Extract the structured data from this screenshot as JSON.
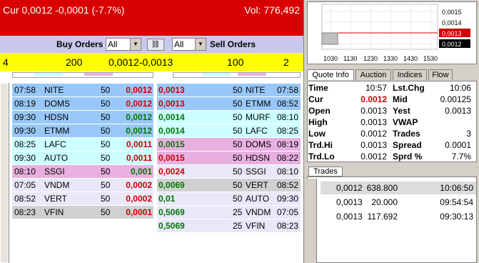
{
  "header": {
    "title": "Cur 0,0012 -0,0001 (-7.7%)",
    "volume": "Vol: 776,492"
  },
  "controls": {
    "buy_label": "Buy Orders",
    "buy_filter": "All",
    "sell_filter": "All",
    "sell_label": "Sell Orders"
  },
  "summary": {
    "bid_count": "4",
    "bid_size": "200",
    "bid_ask": "0,0012-0,0013",
    "ask_size": "100",
    "ask_count": "2"
  },
  "buy_orders": [
    {
      "time": "07:58",
      "mm": "NITE",
      "size": "50",
      "price": "0,0012",
      "color": "red"
    },
    {
      "time": "08:19",
      "mm": "DOMS",
      "size": "50",
      "price": "0,0012",
      "color": "red"
    },
    {
      "time": "09:30",
      "mm": "HDSN",
      "size": "50",
      "price": "0,0012",
      "color": "grn"
    },
    {
      "time": "09:30",
      "mm": "ETMM",
      "size": "50",
      "price": "0,0012",
      "color": "grn"
    },
    {
      "time": "08:25",
      "mm": "LAFC",
      "size": "50",
      "price": "0,0011",
      "color": "red"
    },
    {
      "time": "09:30",
      "mm": "AUTO",
      "size": "50",
      "price": "0,0011",
      "color": "red"
    },
    {
      "time": "08:10",
      "mm": "SSGI",
      "size": "50",
      "price": "0,001",
      "color": "grn"
    },
    {
      "time": "07:05",
      "mm": "VNDM",
      "size": "50",
      "price": "0,0002",
      "color": "red"
    },
    {
      "time": "08:52",
      "mm": "VERT",
      "size": "50",
      "price": "0,0002",
      "color": "red"
    },
    {
      "time": "08:23",
      "mm": "VFIN",
      "size": "50",
      "price": "0,0001",
      "color": "red"
    }
  ],
  "sell_orders": [
    {
      "price": "0,0013",
      "size": "50",
      "mm": "NITE",
      "time": "07:58",
      "color": "red"
    },
    {
      "price": "0,0013",
      "size": "50",
      "mm": "ETMM",
      "time": "08:52",
      "color": "red"
    },
    {
      "price": "0,0014",
      "size": "50",
      "mm": "MURF",
      "time": "08:10",
      "color": "grn"
    },
    {
      "price": "0,0014",
      "size": "50",
      "mm": "LAFC",
      "time": "08:25",
      "color": "grn"
    },
    {
      "price": "0,0015",
      "size": "50",
      "mm": "DOMS",
      "time": "08:19",
      "color": "grn"
    },
    {
      "price": "0,0015",
      "size": "50",
      "mm": "HDSN",
      "time": "08:22",
      "color": "red"
    },
    {
      "price": "0,0024",
      "size": "50",
      "mm": "SSGI",
      "time": "08:10",
      "color": "red"
    },
    {
      "price": "0,0069",
      "size": "50",
      "mm": "VERT",
      "time": "08:52",
      "color": "grn"
    },
    {
      "price": "0,01",
      "size": "50",
      "mm": "AUTO",
      "time": "09:30",
      "color": "grn"
    },
    {
      "price": "0,5069",
      "size": "25",
      "mm": "VNDM",
      "time": "07:05",
      "color": "grn"
    },
    {
      "price": "0,5069",
      "size": "25",
      "mm": "VFIN",
      "time": "08:23",
      "color": "grn"
    }
  ],
  "chart": {
    "x_ticks": [
      "1030",
      "1130",
      "1230",
      "1330",
      "1430",
      "1530"
    ],
    "y_ticks": [
      "0,0015",
      "0,0014",
      "0,0013",
      "0,0012"
    ]
  },
  "tabs": [
    "Quote Info",
    "Auction",
    "Indices",
    "Flow"
  ],
  "quote": {
    "time_label": "Time",
    "time": "10:57",
    "lstchg_label": "Lst.Chg",
    "lstchg": "10:06",
    "cur_label": "Cur",
    "cur": "0.0012",
    "mid_label": "Mid",
    "mid": "0.00125",
    "open_label": "Open",
    "open": "0.0013",
    "yest_label": "Yest",
    "yest": "0.0013",
    "high_label": "High",
    "high": "0.0013",
    "vwap_label": "VWAP",
    "vwap": "",
    "low_label": "Low",
    "low": "0.0012",
    "trades_label": "Trades",
    "trades": "3",
    "trdhi_label": "Trd.Hi",
    "trdhi": "0.0013",
    "spread_label": "Spread",
    "spread": "0.0001",
    "trdlo_label": "Trd.Lo",
    "trdlo": "0.0012",
    "sprd_label": "Sprd %",
    "sprd": "7.7%"
  },
  "trades_tab": "Trades",
  "trades": [
    {
      "price": "0,0012",
      "volume": "638.800",
      "time": "10:06:50"
    },
    {
      "price": "0,0013",
      "volume": "20.000",
      "time": "09:54:54"
    },
    {
      "price": "0,0013",
      "volume": "117.692",
      "time": "09:30:13"
    }
  ],
  "colors": {
    "header": "#d80000",
    "summary": "#ffff00",
    "row_blue": "#99c8f8",
    "row_cyan": "#ccffff",
    "row_pink": "#e8b0e0",
    "row_lav": "#e8e8f8",
    "row_grey": "#d0d0d0"
  }
}
